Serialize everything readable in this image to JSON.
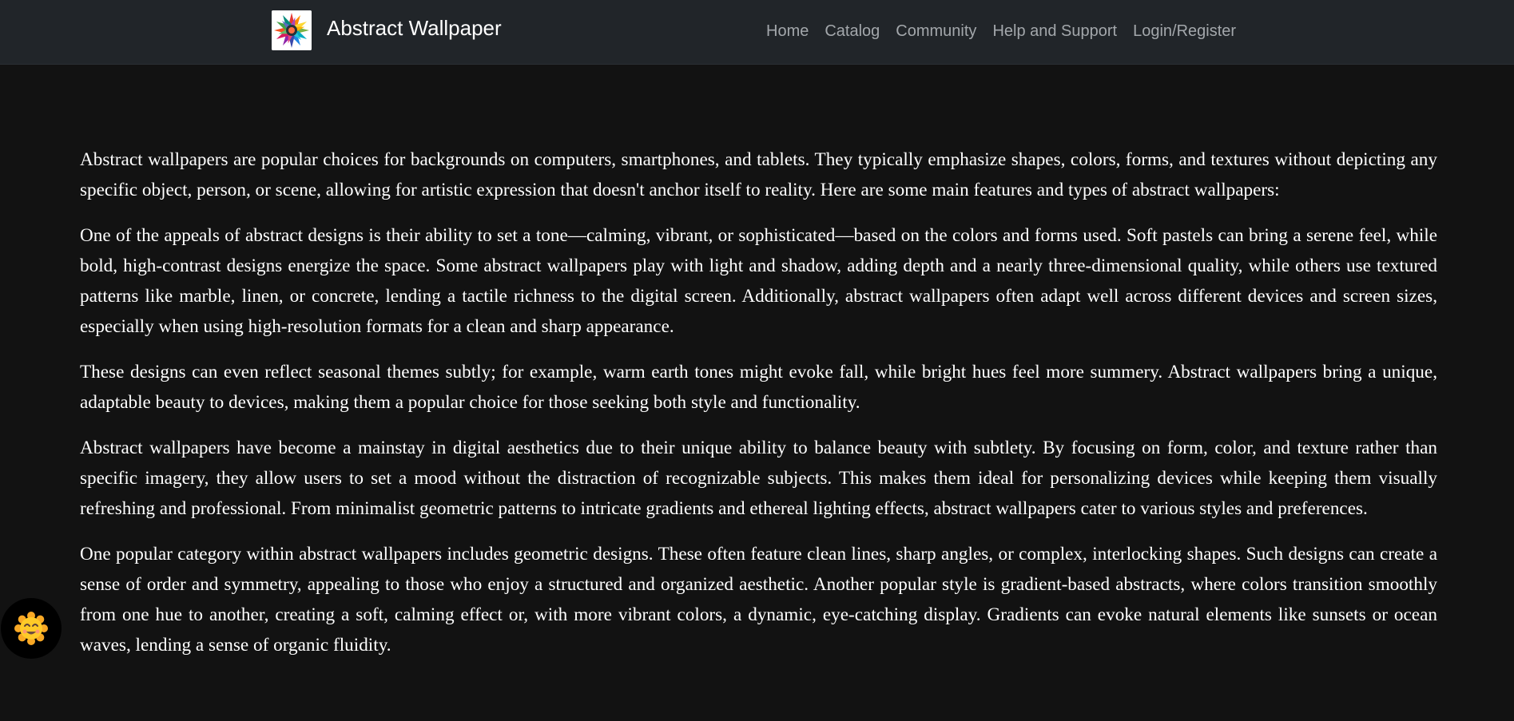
{
  "header": {
    "logo_icon": "colorful-burst-logo-icon",
    "title": "Abstract Wallpaper",
    "nav": [
      {
        "label": "Home"
      },
      {
        "label": "Catalog"
      },
      {
        "label": "Community"
      },
      {
        "label": "Help and Support"
      },
      {
        "label": "Login/Register"
      }
    ]
  },
  "main": {
    "paragraphs": [
      "Abstract wallpapers are popular choices for backgrounds on computers, smartphones, and tablets. They typically emphasize shapes, colors, forms, and textures without depicting any specific object, person, or scene, allowing for artistic expression that doesn't anchor itself to reality. Here are some main features and types of abstract wallpapers:",
      "One of the appeals of abstract designs is their ability to set a tone—calming, vibrant, or sophisticated—based on the colors and forms used. Soft pastels can bring a serene feel, while bold, high-contrast designs energize the space. Some abstract wallpapers play with light and shadow, adding depth and a nearly three-dimensional quality, while others use textured patterns like marble, linen, or concrete, lending a tactile richness to the digital screen. Additionally, abstract wallpapers often adapt well across different devices and screen sizes, especially when using high-resolution formats for a clean and sharp appearance.",
      "These designs can even reflect seasonal themes subtly; for example, warm earth tones might evoke fall, while bright hues feel more summery. Abstract wallpapers bring a unique, adaptable beauty to devices, making them a popular choice for those seeking both style and functionality.",
      "Abstract wallpapers have become a mainstay in digital aesthetics due to their unique ability to balance beauty with subtlety. By focusing on form, color, and texture rather than specific imagery, they allow users to set a mood without the distraction of recognizable subjects. This makes them ideal for personalizing devices while keeping them visually refreshing and professional. From minimalist geometric patterns to intricate gradients and ethereal lighting effects, abstract wallpapers cater to various styles and preferences.",
      "One popular category within abstract wallpapers includes geometric designs. These often feature clean lines, sharp angles, or complex, interlocking shapes. Such designs can create a sense of order and symmetry, appealing to those who enjoy a structured and organized aesthetic. Another popular style is gradient-based abstracts, where colors transition smoothly from one hue to another, creating a soft, calming effect or, with more vibrant colors, a dynamic, eye-catching display. Gradients can evoke natural elements like sunsets or ocean waves, lending a sense of organic fluidity."
    ]
  },
  "assistant": {
    "icon": "smiling-face-icon"
  },
  "colors": {
    "page_background": "#121212",
    "navbar_background": "#212529",
    "nav_link": "#a3a7ab",
    "text": "#ffffff"
  }
}
